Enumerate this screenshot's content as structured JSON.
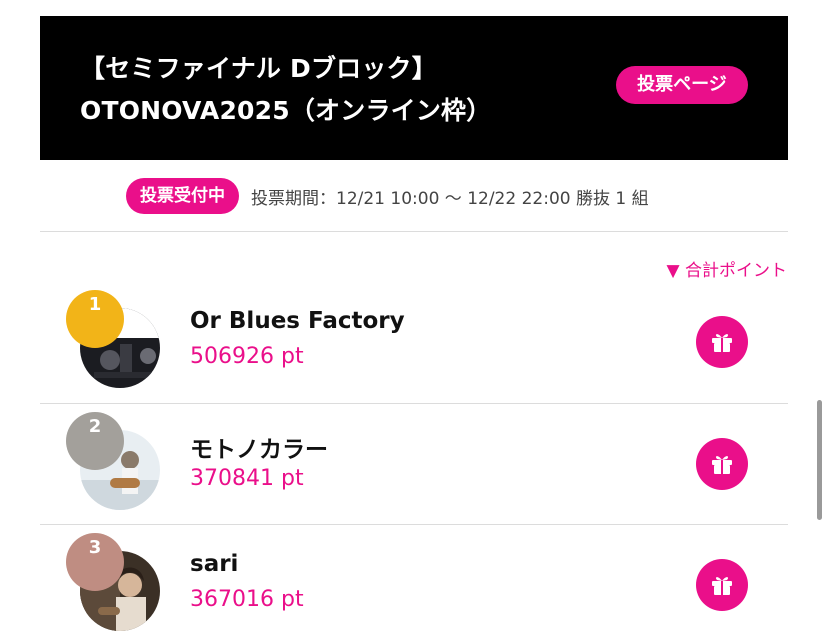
{
  "banner": {
    "title_line1": "【セミファイナル Dブロック】",
    "title_line2": "OTONOVA2025（オンライン枠）",
    "vote_page_button": "投票ページ"
  },
  "status": {
    "badge": "投票受付中",
    "period": "投票期間：12/21 10:00 〜 12/22 22:00  勝抜 1 組"
  },
  "sort": {
    "label": "▼ 合計ポイント"
  },
  "ranking": [
    {
      "rank": "1",
      "name": "Or Blues Factory",
      "points": "506926 pt",
      "rank_color": "#f2b418"
    },
    {
      "rank": "2",
      "name": "モトノカラー",
      "points": "370841 pt",
      "rank_color": "#a3a09b"
    },
    {
      "rank": "3",
      "name": "sari",
      "points": "367016 pt",
      "rank_color": "#bf8d82"
    }
  ],
  "colors": {
    "accent": "#ea0f8a",
    "banner_bg": "#000000"
  },
  "icons": {
    "gift": "gift-icon"
  }
}
